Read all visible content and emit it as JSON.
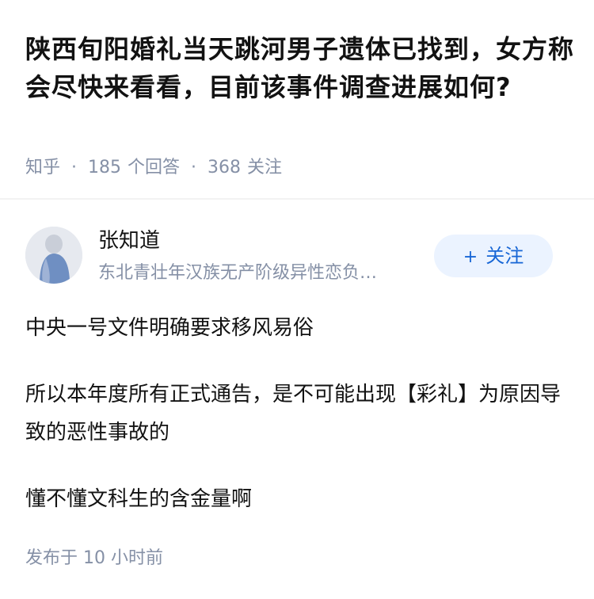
{
  "question": {
    "title": "陕西旬阳婚礼当天跳河男子遗体已找到，女方称会尽快来看看，目前该事件调查进展如何?",
    "source": "知乎",
    "answers_count": "185",
    "answers_label": "个回答",
    "follows_count": "368",
    "follows_label": "关注"
  },
  "author": {
    "name": "张知道",
    "bio": "东北青壮年汉族无产阶级异性恋负…",
    "follow_label": "关注",
    "follow_icon": "+"
  },
  "answer": {
    "paragraphs": [
      "中央一号文件明确要求移风易俗",
      "所以本年度所有正式通告，是不可能出现【彩礼】为原因导致的恶性事故的",
      "懂不懂文科生的含金量啊"
    ],
    "published": "发布于 10 小时前"
  },
  "colors": {
    "meta_gray": "#8590a6",
    "follow_bg": "#ebf3ff",
    "follow_text": "#1766d6"
  }
}
